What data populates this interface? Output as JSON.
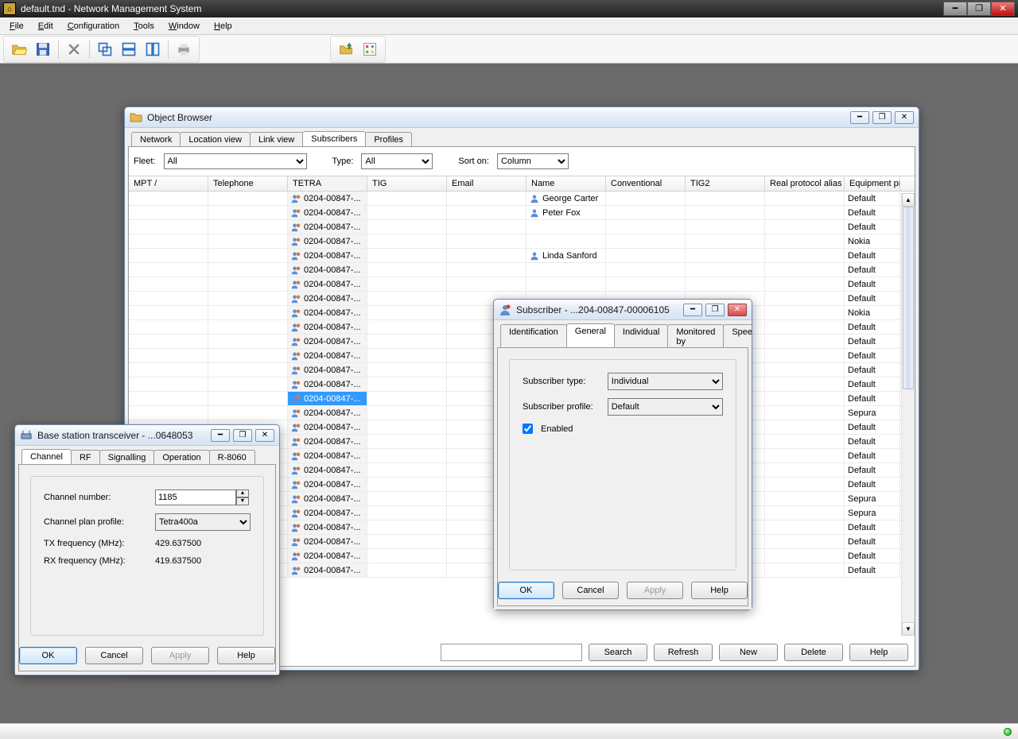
{
  "titlebar": {
    "title": "default.tnd - Network Management System"
  },
  "menu": {
    "file": "File",
    "edit": "Edit",
    "config": "Configuration",
    "tools": "Tools",
    "window": "Window",
    "help": "Help"
  },
  "object_browser": {
    "title": "Object Browser",
    "tabs": {
      "network": "Network",
      "locationview": "Location view",
      "linkview": "Link view",
      "subscribers": "Subscribers",
      "profiles": "Profiles"
    },
    "filters": {
      "fleet_label": "Fleet:",
      "fleet_value": "All",
      "type_label": "Type:",
      "type_value": "All",
      "sort_label": "Sort on:",
      "sort_value": "Column"
    },
    "columns": [
      "MPT /",
      "Telephone",
      "TETRA",
      "TIG",
      "Email",
      "Name",
      "Conventional",
      "TIG2",
      "Real protocol alias",
      "Equipment pr"
    ],
    "rows": [
      {
        "tetra": "0204-00847-...",
        "name": "George Carter",
        "equip": "Default"
      },
      {
        "tetra": "0204-00847-...",
        "name": "Peter Fox",
        "equip": "Default"
      },
      {
        "tetra": "0204-00847-...",
        "name": "",
        "equip": "Default"
      },
      {
        "tetra": "0204-00847-...",
        "name": "",
        "equip": "Nokia"
      },
      {
        "tetra": "0204-00847-...",
        "name": "Linda Sanford",
        "equip": "Default"
      },
      {
        "tetra": "0204-00847-...",
        "name": "",
        "equip": "Default"
      },
      {
        "tetra": "0204-00847-...",
        "name": "",
        "equip": "Default"
      },
      {
        "tetra": "0204-00847-...",
        "name": "",
        "equip": "Default"
      },
      {
        "tetra": "0204-00847-...",
        "name": "",
        "equip": "Nokia"
      },
      {
        "tetra": "0204-00847-...",
        "name": "",
        "equip": "Default"
      },
      {
        "tetra": "0204-00847-...",
        "name": "",
        "equip": "Default"
      },
      {
        "tetra": "0204-00847-...",
        "name": "",
        "equip": "Default"
      },
      {
        "tetra": "0204-00847-...",
        "name": "",
        "equip": "Default"
      },
      {
        "tetra": "0204-00847-...",
        "name": "",
        "equip": "Default"
      },
      {
        "tetra": "0204-00847-...",
        "name": "",
        "equip": "Default",
        "selected": true
      },
      {
        "tetra": "0204-00847-...",
        "name": "",
        "equip": "Sepura"
      },
      {
        "tetra": "0204-00847-...",
        "name": "",
        "equip": "Default"
      },
      {
        "tetra": "0204-00847-...",
        "name": "",
        "equip": "Default"
      },
      {
        "tetra": "0204-00847-...",
        "name": "",
        "equip": "Default"
      },
      {
        "tetra": "0204-00847-...",
        "name": "",
        "equip": "Default"
      },
      {
        "tetra": "0204-00847-...",
        "name": "",
        "equip": "Default"
      },
      {
        "tetra": "0204-00847-...",
        "name": "",
        "equip": "Sepura"
      },
      {
        "tetra": "0204-00847-...",
        "name": "",
        "equip": "Sepura"
      },
      {
        "tetra": "0204-00847-...",
        "name": "",
        "equip": "Default"
      },
      {
        "tetra": "0204-00847-...",
        "name": "",
        "equip": "Default"
      },
      {
        "tetra": "0204-00847-...",
        "name": "",
        "equip": "Default"
      },
      {
        "tetra": "0204-00847-...",
        "name": "",
        "equip": "Default"
      }
    ],
    "btns": {
      "search": "Search",
      "refresh": "Refresh",
      "new": "New",
      "delete": "Delete",
      "help": "Help"
    }
  },
  "subscriber_dialog": {
    "title": "Subscriber - ...204-00847-00006105",
    "tabs": {
      "ident": "Identification",
      "general": "General",
      "individual": "Individual",
      "monitored": "Monitored by",
      "spee": "Spee"
    },
    "fields": {
      "type_label": "Subscriber type:",
      "type_value": "Individual",
      "profile_label": "Subscriber profile:",
      "profile_value": "Default",
      "enabled_label": "Enabled",
      "enabled_value": true
    },
    "btns": {
      "ok": "OK",
      "cancel": "Cancel",
      "apply": "Apply",
      "help": "Help"
    }
  },
  "bts_dialog": {
    "title": "Base station transceiver - ...0648053",
    "tabs": {
      "channel": "Channel",
      "rf": "RF",
      "signalling": "Signalling",
      "operation": "Operation",
      "r8060": "R-8060"
    },
    "fields": {
      "chnum_label": "Channel number:",
      "chnum_value": "1185",
      "chplan_label": "Channel plan profile:",
      "chplan_value": "Tetra400a",
      "tx_label": "TX frequency (MHz):",
      "tx_value": "429.637500",
      "rx_label": "RX frequency (MHz):",
      "rx_value": "419.637500"
    },
    "btns": {
      "ok": "OK",
      "cancel": "Cancel",
      "apply": "Apply",
      "help": "Help"
    }
  }
}
